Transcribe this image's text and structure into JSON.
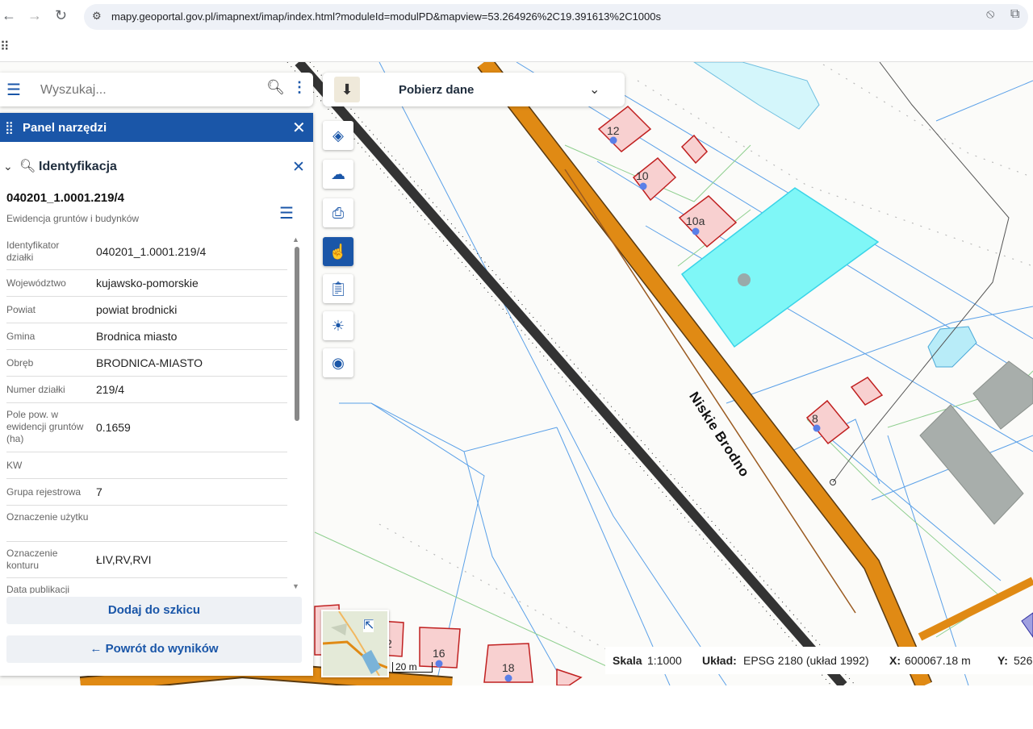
{
  "browser": {
    "url": "mapy.geoportal.gov.pl/imapnext/imap/index.html?moduleId=modulPD&mapview=53.264926%2C19.391613%2C1000s"
  },
  "search": {
    "placeholder": "Wyszukaj..."
  },
  "download": {
    "label": "Pobierz dane"
  },
  "panel": {
    "title": "Panel narzędzi",
    "section_title": "Identyfikacja",
    "parcel_id": "040201_1.0001.219/4",
    "source": "Ewidencja gruntów i budynków",
    "rows": [
      {
        "label": "Identyfikator działki",
        "value": "040201_1.0001.219/4"
      },
      {
        "label": "Województwo",
        "value": "kujawsko-pomorskie"
      },
      {
        "label": "Powiat",
        "value": "powiat brodnicki"
      },
      {
        "label": "Gmina",
        "value": "Brodnica miasto"
      },
      {
        "label": "Obręb",
        "value": "BRODNICA-MIASTO"
      },
      {
        "label": "Numer działki",
        "value": "219/4"
      },
      {
        "label": "Pole pow. w ewidencji gruntów (ha)",
        "value": "0.1659"
      },
      {
        "label": "KW",
        "value": ""
      },
      {
        "label": "Grupa rejestrowa",
        "value": "7"
      },
      {
        "label": "Oznaczenie użytku",
        "value": ""
      },
      {
        "label": "Oznaczenie konturu",
        "value": "ŁIV,RV,RVI"
      },
      {
        "label": "Data publikacji",
        "value": ""
      }
    ],
    "add_button": "Dodaj do szkicu",
    "back_button": "Powrót do wyników"
  },
  "map": {
    "street_name": "Niskie Brodno",
    "scale_bar": "20 m",
    "house_numbers": [
      "12",
      "10",
      "10a",
      "8",
      "16",
      "18",
      "2"
    ]
  },
  "status": {
    "scale_label": "Skala",
    "scale_value": "1:1000",
    "crs_label": "Układ:",
    "crs_value": "EPSG 2180 (układ 1992)",
    "x_label": "X:",
    "x_value": "600067.18 m",
    "y_label": "Y:",
    "y_value": "526"
  },
  "colors": {
    "accent": "#1a56a8",
    "road": "#e08a14",
    "selected_parcel": "#7ff7f7"
  }
}
